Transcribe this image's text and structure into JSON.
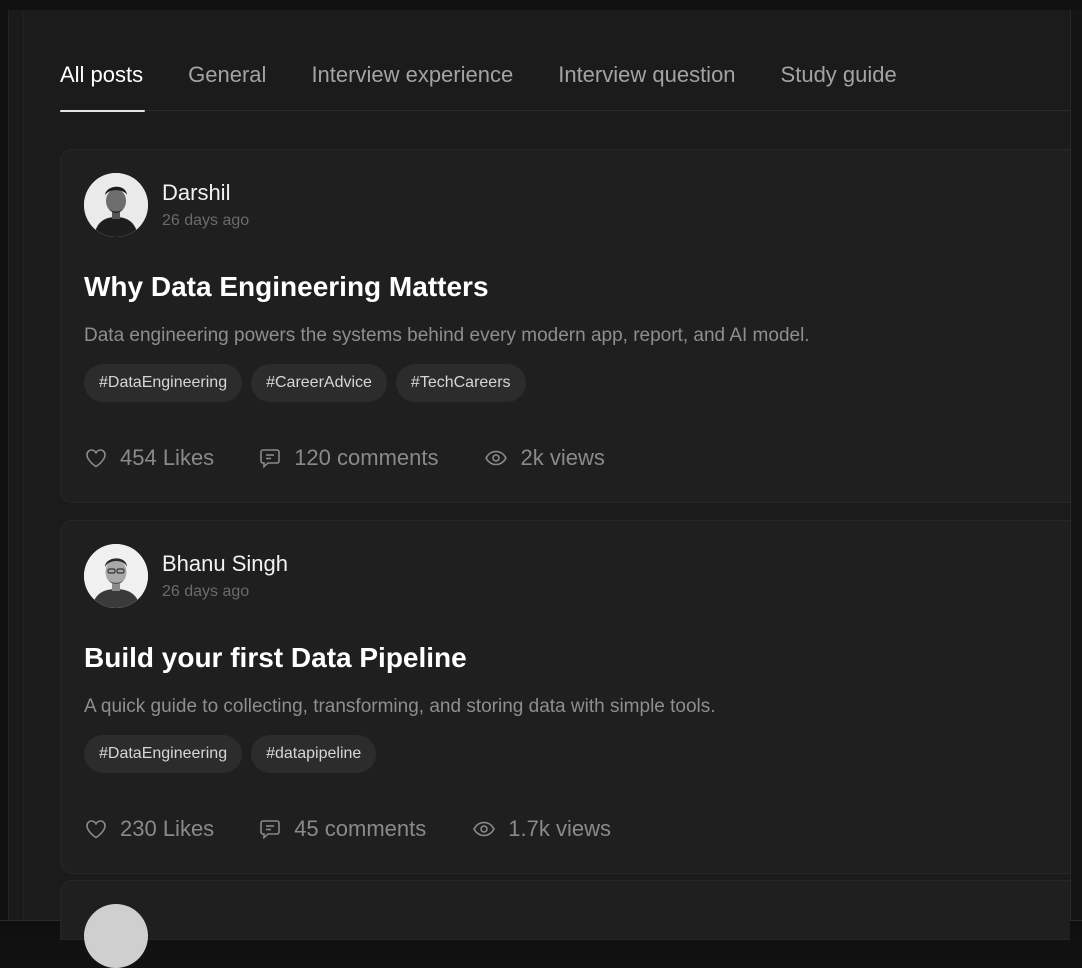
{
  "tabs": [
    {
      "label": "All posts",
      "active": true
    },
    {
      "label": "General",
      "active": false
    },
    {
      "label": "Interview experience",
      "active": false
    },
    {
      "label": "Interview question",
      "active": false
    },
    {
      "label": "Study guide",
      "active": false
    }
  ],
  "posts": [
    {
      "author": "Darshil",
      "time": "26 days ago",
      "title": "Why Data Engineering Matters",
      "description": "Data engineering powers the systems behind every modern app, report, and AI model.",
      "tags": [
        "#DataEngineering",
        "#CareerAdvice",
        "#TechCareers"
      ],
      "likes": "454 Likes",
      "comments": "120 comments",
      "views": "2k views"
    },
    {
      "author": "Bhanu Singh",
      "time": "26 days ago",
      "title": "Build your first Data Pipeline",
      "description": "A quick guide to collecting, transforming, and storing data with simple tools.",
      "tags": [
        "#DataEngineering",
        "#datapipeline"
      ],
      "likes": "230 Likes",
      "comments": "45 comments",
      "views": "1.7k views"
    }
  ],
  "icons": {
    "like": "heart-icon",
    "comment": "comment-icon",
    "views": "eye-icon"
  },
  "colors": {
    "background": "#111111",
    "card": "#1f1f1f",
    "tag": "#2c2c2c",
    "active_tab": "#ffffff",
    "muted_text": "#8a8a8a"
  }
}
